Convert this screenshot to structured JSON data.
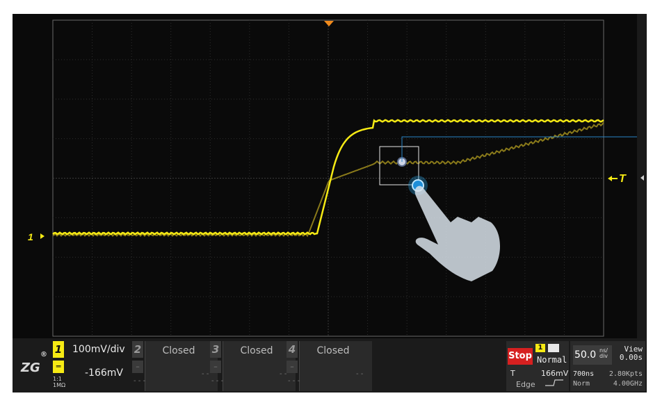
{
  "screen": {
    "trigger_marker_label": "T",
    "channel_marker_label": "1"
  },
  "channels": [
    {
      "id": "1",
      "vdiv": "100mV/div",
      "offset": "-166mV",
      "ratio_top": "1:1",
      "ratio_bottom": "1MΩ",
      "coupling": "DC"
    },
    {
      "id": "2",
      "state": "Closed",
      "dash_left": "- - -",
      "dash_right": "- -"
    },
    {
      "id": "3",
      "state": "Closed",
      "dash_left": "- - -",
      "dash_right": "- -"
    },
    {
      "id": "4",
      "state": "Closed",
      "dash_left": "- - -",
      "dash_right": "- -"
    }
  ],
  "trigger": {
    "run_state": "Stop",
    "source": "1",
    "mode": "Normal",
    "label": "T",
    "level": "166mV",
    "type": "Edge"
  },
  "timebase": {
    "scale": "50.0",
    "unit_top": "ns/",
    "unit_bottom": "div",
    "view_label": "View",
    "view_value": "0.00s",
    "time_span": "700ns",
    "memory_depth": "2.80Kpts",
    "acq_mode": "Norm",
    "sample_rate": "4.00GHz"
  },
  "logo": {
    "mark": "ZG",
    "registered": "®"
  },
  "colors": {
    "trace": "#f6ea14",
    "ghost_trace": "#8a7a1a",
    "grid": "#3a3a3a",
    "stop": "#d62020",
    "touch_glow": "#2aa6e8"
  }
}
